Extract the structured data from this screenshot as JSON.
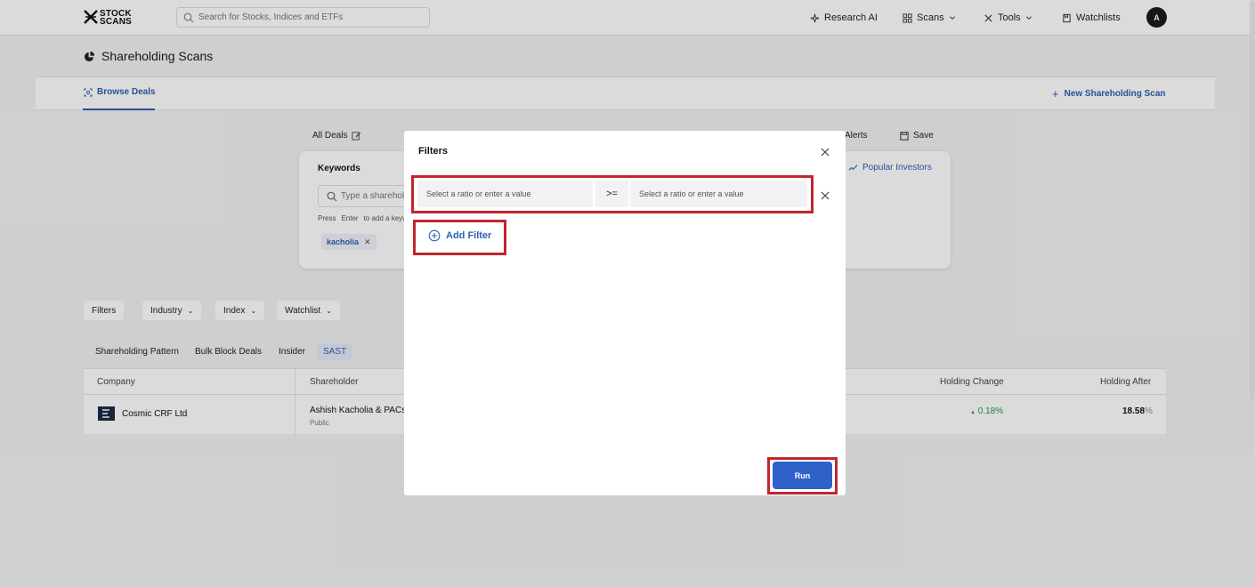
{
  "nav": {
    "logo_line1": "STOCK",
    "logo_line2": "SCANS",
    "search_placeholder": "Search for Stocks, Indices and ETFs",
    "research_ai": "Research AI",
    "scans": "Scans",
    "tools": "Tools",
    "watchlists": "Watchlists",
    "avatar_initial": "A"
  },
  "page": {
    "title": "Shareholding Scans",
    "tab_browse": "Browse Deals",
    "new_scan": "New Shareholding Scan",
    "all_deals": "All Deals",
    "alerts": "Alerts",
    "save": "Save"
  },
  "keywords": {
    "label": "Keywords",
    "placeholder": "Type a shareholder",
    "press": "Press",
    "enter": "Enter",
    "to_add": "to add a keyword",
    "chip": "kacholia",
    "popular_investors": "Popular Investors"
  },
  "filters_row": {
    "filters": "Filters",
    "industry": "Industry",
    "index": "Index",
    "watchlist": "Watchlist"
  },
  "subtabs": [
    "Shareholding Pattern",
    "Bulk Block Deals",
    "Insider",
    "SAST"
  ],
  "table": {
    "headers": {
      "company": "Company",
      "shareholder": "Shareholder",
      "holding_change": "Holding Change",
      "holding_after": "Holding After"
    },
    "rows": [
      {
        "company": "Cosmic CRF Ltd",
        "shareholder": "Ashish Kacholia & PACs",
        "shareholder_type": "Public",
        "holding_change": "0.18%",
        "holding_after": "18.58",
        "holding_after_unit": "%"
      }
    ]
  },
  "modal": {
    "title": "Filters",
    "left_placeholder": "Select a ratio or enter a value",
    "operator": ">=",
    "right_placeholder": "Select a ratio or enter a value",
    "add_filter": "Add Filter",
    "run": "Run"
  },
  "colors": {
    "accent": "#2f5fb3",
    "run_button": "#2e62c8",
    "highlight": "#c0262d",
    "positive": "#1e9e4a"
  }
}
